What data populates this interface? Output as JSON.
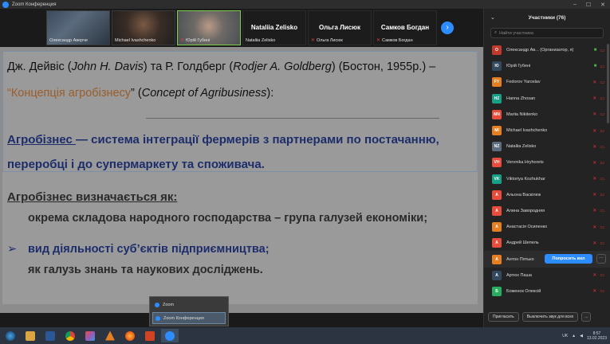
{
  "window": {
    "title": "Zoom Конференция"
  },
  "video_strip": {
    "tiles": [
      {
        "name": "Олександр Аверче",
        "muted": false
      },
      {
        "name": "Michael Ivashchenko",
        "muted": false
      },
      {
        "name": "Юрій Губені",
        "muted": true
      },
      {
        "big": "Nataliia Zelisko",
        "name": "Nataliia Zelisko",
        "muted": false
      },
      {
        "big": "Ольга Лисюк",
        "name": "Ольга Лисюк",
        "muted": true
      },
      {
        "big": "Самков Богдан",
        "name": "Самков Богдан",
        "muted": true
      }
    ]
  },
  "slide": {
    "line1": {
      "a": "Дж. Дейвіс (",
      "a_it": "John H. Davis",
      "b": ") та Р. Голдберг (",
      "b_it": "Rodjer A. Goldberg",
      "c": ") (Бостон, 1955р.)  –"
    },
    "line2": {
      "q": "“Концепція агробізнесу",
      "mid": "” (",
      "it": "Concept of Agribusiness",
      "end": "):"
    },
    "def_term": "Агробізнес ",
    "def_rest": "— система інтеграції фермерів з партнерами по постачанню,",
    "def_line2": "переробці і до супермаркету та споживача.",
    "heading": "Агробізнес визначається як:",
    "bullets": [
      {
        "marker": "",
        "text": "окрема складова народного господарства – група галузей економіки;"
      },
      {
        "marker": "➢",
        "text": "вид діяльності суб’єктів підприємництва;"
      },
      {
        "marker": "",
        "text": "як галузь знань та наукових досліджень."
      }
    ]
  },
  "taskbar_popup": {
    "items": [
      "Zoom",
      "Zoom Конференция"
    ]
  },
  "taskbar": {
    "language": "UK",
    "time": "8:57",
    "date": "13.02.2023"
  },
  "participants": {
    "title": "Участники (76)",
    "search_placeholder": "Найти участника",
    "people": [
      {
        "initials": "О",
        "color": "#c0392b",
        "name": "Олександр Ав... (Организатор, я)",
        "state": "on"
      },
      {
        "initials": "Ю",
        "color": "#34495e",
        "name": "Юрій Губені",
        "state": "on"
      },
      {
        "initials": "FY",
        "color": "#e67e22",
        "name": "Fedorov Yaroslav",
        "state": "muted"
      },
      {
        "initials": "HZ",
        "color": "#16a085",
        "name": "Hanna Zhosan",
        "state": "muted"
      },
      {
        "initials": "MN",
        "color": "#e74c3c",
        "name": "Mariia Nikitenko",
        "state": "muted"
      },
      {
        "initials": "MI",
        "color": "#e67e22",
        "name": "Michael Ivashchenko",
        "state": "muted"
      },
      {
        "initials": "NZ",
        "color": "#5d6d7e",
        "name": "Nataliia Zelisko",
        "state": "muted"
      },
      {
        "initials": "VH",
        "color": "#e74c3c",
        "name": "Veronika Hryhorets",
        "state": "muted"
      },
      {
        "initials": "VK",
        "color": "#16a085",
        "name": "Viktoriya Kozhukhar",
        "state": "muted"
      },
      {
        "initials": "А",
        "color": "#e74c3c",
        "name": "Альона Васкілюк",
        "state": "muted"
      },
      {
        "initials": "А",
        "color": "#e74c3c",
        "name": "Алина Завородняя",
        "state": "muted"
      },
      {
        "initials": "А",
        "color": "#e67e22",
        "name": "Анастасія Осипенко",
        "state": "muted"
      },
      {
        "initials": "А",
        "color": "#e74c3c",
        "name": "Андрей Шепель",
        "state": "muted"
      },
      {
        "initials": "А",
        "color": "#e67e22",
        "name": "Антон Пятько",
        "state": "ask",
        "ask_label": "Попросить вкл"
      },
      {
        "initials": "А",
        "color": "#34495e",
        "name": "Артюх Паша",
        "state": "muted"
      },
      {
        "initials": "Б",
        "color": "#27ae60",
        "name": "Боженок Олексій",
        "state": "muted"
      }
    ],
    "invite_label": "Пригласить",
    "mute_all_label": "Выключить звук для всех",
    "more_label": "..."
  }
}
